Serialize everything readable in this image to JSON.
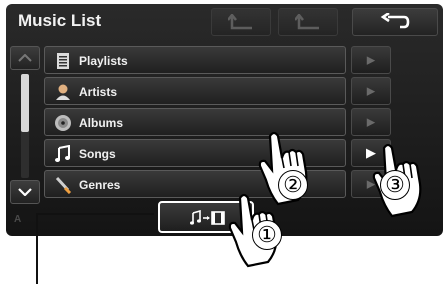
{
  "header": {
    "title": "Music List"
  },
  "list": {
    "items": [
      {
        "label": "Playlists",
        "icon": "playlist-icon"
      },
      {
        "label": "Artists",
        "icon": "artist-icon"
      },
      {
        "label": "Albums",
        "icon": "album-icon"
      },
      {
        "label": "Songs",
        "icon": "music-note-icon"
      },
      {
        "label": "Genres",
        "icon": "genre-icon"
      }
    ],
    "active_play_row": 3
  },
  "footer": {
    "faded_text": "A"
  },
  "callouts": {
    "one": "①",
    "two": "②",
    "three": "③"
  }
}
